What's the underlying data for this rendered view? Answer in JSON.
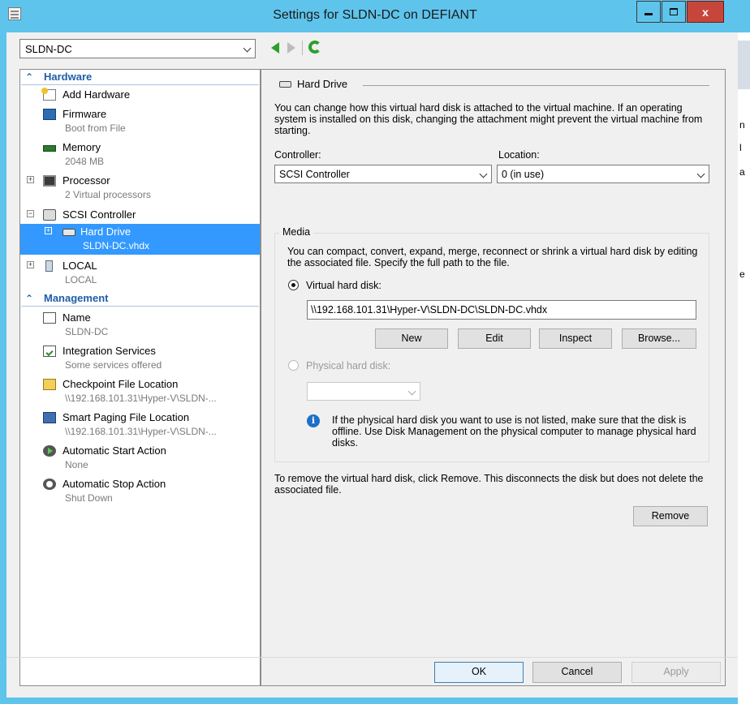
{
  "window": {
    "title": "Settings for SLDN-DC on DEFIANT",
    "controls": {
      "minimize": "",
      "maximize": "",
      "close": "x"
    }
  },
  "vm_selector": {
    "selected": "SLDN-DC"
  },
  "tree": {
    "hardware_header": "Hardware",
    "management_header": "Management",
    "hardware_items": [
      {
        "label": "Add Hardware",
        "sub": ""
      },
      {
        "label": "Firmware",
        "sub": "Boot from File"
      },
      {
        "label": "Memory",
        "sub": "2048 MB"
      },
      {
        "label": "Processor",
        "sub": "2 Virtual processors"
      },
      {
        "label": "SCSI Controller",
        "sub": ""
      },
      {
        "label": "Hard Drive",
        "sub": "SLDN-DC.vhdx"
      },
      {
        "label": "LOCAL",
        "sub": "LOCAL"
      }
    ],
    "management_items": [
      {
        "label": "Name",
        "sub": "SLDN-DC"
      },
      {
        "label": "Integration Services",
        "sub": "Some services offered"
      },
      {
        "label": "Checkpoint File Location",
        "sub": "\\\\192.168.101.31\\Hyper-V\\SLDN-..."
      },
      {
        "label": "Smart Paging File Location",
        "sub": "\\\\192.168.101.31\\Hyper-V\\SLDN-..."
      },
      {
        "label": "Automatic Start Action",
        "sub": "None"
      },
      {
        "label": "Automatic Stop Action",
        "sub": "Shut Down"
      }
    ],
    "expanders": {
      "plus": "+",
      "minus": "−"
    }
  },
  "panel": {
    "group_title": "Hard Drive",
    "intro": "You can change how this virtual hard disk is attached to the virtual machine. If an operating system is installed on this disk, changing the attachment might prevent the virtual machine from starting.",
    "controller_label": "Controller:",
    "controller_value": "SCSI Controller",
    "location_label": "Location:",
    "location_value": "0 (in use)",
    "media_label": "Media",
    "media_desc": "You can compact, convert, expand, merge, reconnect or shrink a virtual hard disk by editing the associated file. Specify the full path to the file.",
    "vhd_label": "Virtual hard disk:",
    "vhd_path": "\\\\192.168.101.31\\Hyper-V\\SLDN-DC\\SLDN-DC.vhdx",
    "buttons": {
      "new": "New",
      "edit": "Edit",
      "inspect": "Inspect",
      "browse": "Browse..."
    },
    "phys_label": "Physical hard disk:",
    "phys_value": "",
    "info_glyph": "i",
    "info_text": "If the physical hard disk you want to use is not listed, make sure that the disk is offline. Use Disk Management on the physical computer to manage physical hard disks.",
    "remove_text": "To remove the virtual hard disk, click Remove. This disconnects the disk but does not delete the associated file.",
    "remove_button": "Remove"
  },
  "footer": {
    "ok": "OK",
    "cancel": "Cancel",
    "apply": "Apply"
  },
  "background_peek": [
    "n",
    "l",
    "a",
    "e"
  ]
}
